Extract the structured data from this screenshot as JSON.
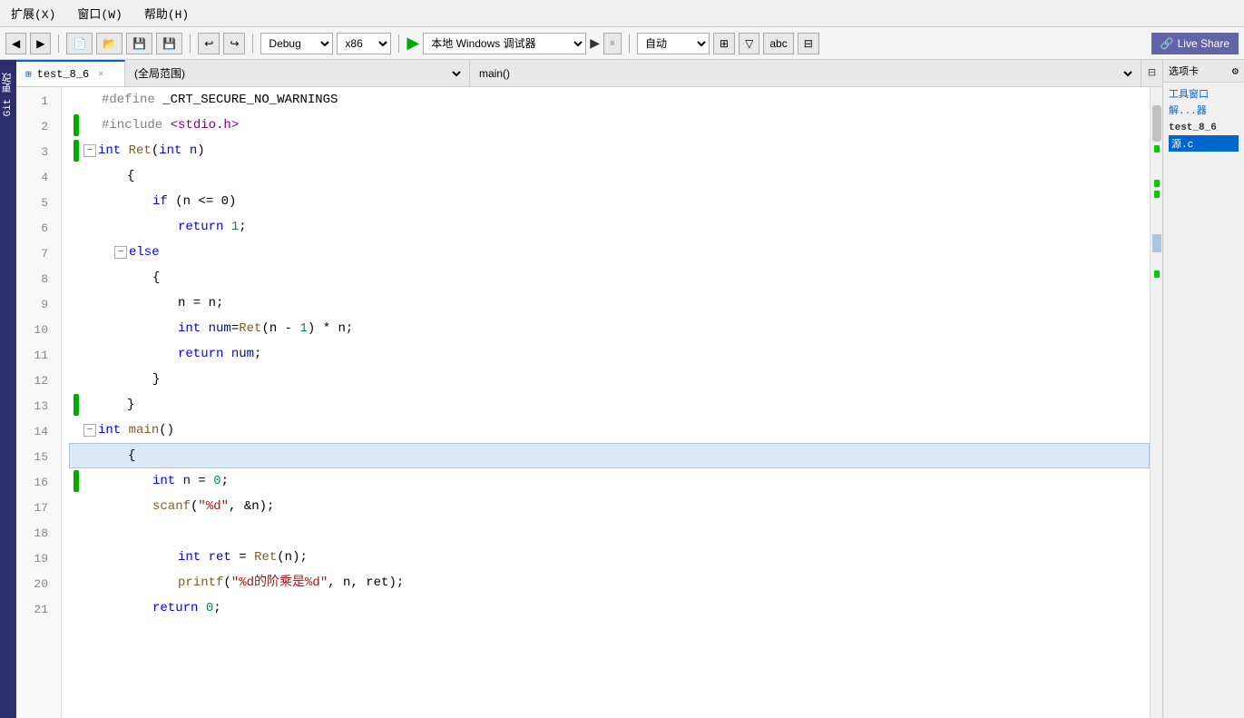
{
  "menubar": {
    "items": [
      "扩展(X)",
      "窗口(W)",
      "帮助(H)"
    ]
  },
  "toolbar": {
    "debug_label": "Debug",
    "platform_label": "x86",
    "run_label": "▶",
    "target_label": "本地 Windows 调试器",
    "run2_label": "▶",
    "auto_label": "自动",
    "live_share_label": "Live Share"
  },
  "tabs": {
    "file_name": "test_8_6",
    "scope_label": "(全局范围)",
    "function_label": "main()"
  },
  "code": {
    "lines": [
      {
        "num": 1,
        "indent": 0,
        "content": "#define _CRT_SECURE_NO_WARNINGS",
        "type": "preprocessor",
        "green": false
      },
      {
        "num": 2,
        "indent": 0,
        "content": "#include <stdio.h>",
        "type": "include",
        "green": true
      },
      {
        "num": 3,
        "indent": 0,
        "content": "int Ret(int n)",
        "type": "funcdef",
        "green": true,
        "fold": true
      },
      {
        "num": 4,
        "indent": 1,
        "content": "{",
        "type": "brace",
        "green": false
      },
      {
        "num": 5,
        "indent": 2,
        "content": "if (n <= 0)",
        "type": "if",
        "green": false
      },
      {
        "num": 6,
        "indent": 3,
        "content": "return 1;",
        "type": "return",
        "green": false
      },
      {
        "num": 7,
        "indent": 2,
        "content": "else",
        "type": "else",
        "green": false,
        "fold": true
      },
      {
        "num": 8,
        "indent": 2,
        "content": "{",
        "type": "brace",
        "green": false
      },
      {
        "num": 9,
        "indent": 3,
        "content": "n = n;",
        "type": "assign",
        "green": false
      },
      {
        "num": 10,
        "indent": 3,
        "content": "int num=Ret(n - 1) * n;",
        "type": "decl",
        "green": false
      },
      {
        "num": 11,
        "indent": 3,
        "content": "return num;",
        "type": "return",
        "green": false
      },
      {
        "num": 12,
        "indent": 2,
        "content": "}",
        "type": "brace",
        "green": false
      },
      {
        "num": 13,
        "indent": 1,
        "content": "}",
        "type": "brace",
        "green": true
      },
      {
        "num": 14,
        "indent": 0,
        "content": "int main()",
        "type": "mainfunc",
        "green": false,
        "fold": true
      },
      {
        "num": 15,
        "indent": 1,
        "content": "{",
        "type": "brace",
        "green": false,
        "current": true
      },
      {
        "num": 16,
        "indent": 2,
        "content": "int n = 0;",
        "type": "decl",
        "green": true
      },
      {
        "num": 17,
        "indent": 2,
        "content": "scanf(\"%d\", &n);",
        "type": "call",
        "green": false
      },
      {
        "num": 18,
        "indent": 2,
        "content": "",
        "type": "empty",
        "green": false
      },
      {
        "num": 19,
        "indent": 3,
        "content": "int ret = Ret(n);",
        "type": "decl",
        "green": false
      },
      {
        "num": 20,
        "indent": 3,
        "content": "printf(\"%d的阶乘是%d\", n, ret);",
        "type": "call",
        "green": false
      },
      {
        "num": 21,
        "indent": 2,
        "content": "return 0;",
        "type": "return",
        "green": false
      }
    ]
  },
  "right_panel": {
    "title": "选项卡",
    "tools_label": "工具窗口",
    "solution_label": "解...器",
    "project_name": "test_8_6",
    "file_name": "源.c"
  },
  "icons": {
    "tab_icon": "⊞",
    "gear_icon": "⚙",
    "play_icon": "▶",
    "split_icon": "⊟"
  }
}
